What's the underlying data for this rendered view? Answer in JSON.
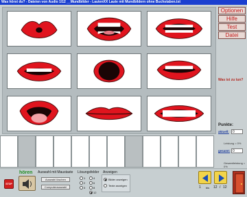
{
  "window": {
    "title": "Was hörst du? - Dateien von Audio 1\\12 __Mundbilder - LautenXX Laute mit Mundbildern ohne Buchstaben.txt"
  },
  "menu": {
    "items": [
      "Optionen",
      "Hilfe",
      "Test",
      "Datei"
    ]
  },
  "sidebar": {
    "question": "Was ist zu tun?",
    "points_title": "Punkte:",
    "aktuell_label": "aktuell:",
    "aktuell_value": "0",
    "leistung_label": "Leistung = 0%",
    "gesamt_label": "gesamt:",
    "gesamt_value": "0",
    "gesamtleistung_label": "Gesamtleistung = 0%"
  },
  "controls": {
    "stop_label": "STOP",
    "hoeren_label": "hören",
    "auswahl_title": "Auswahl mit Maustaste",
    "auswahl_loeschen": "Auswahl löschen",
    "computerauswahl": "Computerauswahl",
    "loesungsfelder_title": "Lösungsfelder",
    "loesungsfelder_options": [
      "1",
      "2",
      "3",
      "4",
      "6",
      "8",
      "12"
    ],
    "anzeigen_title": "Anzeigen",
    "anzeigen_options": [
      "Bilder anzeigen",
      "Texte anzeigen"
    ]
  },
  "pager": {
    "current": "1",
    "bis_label": "bis",
    "to": "12",
    "separator": "/",
    "total": "12"
  },
  "colors": {
    "lip_red": "#e0141e",
    "menu_text": "#c21818",
    "title_bar": "#1a3fd0",
    "nav_yellow": "#f2d44a"
  }
}
